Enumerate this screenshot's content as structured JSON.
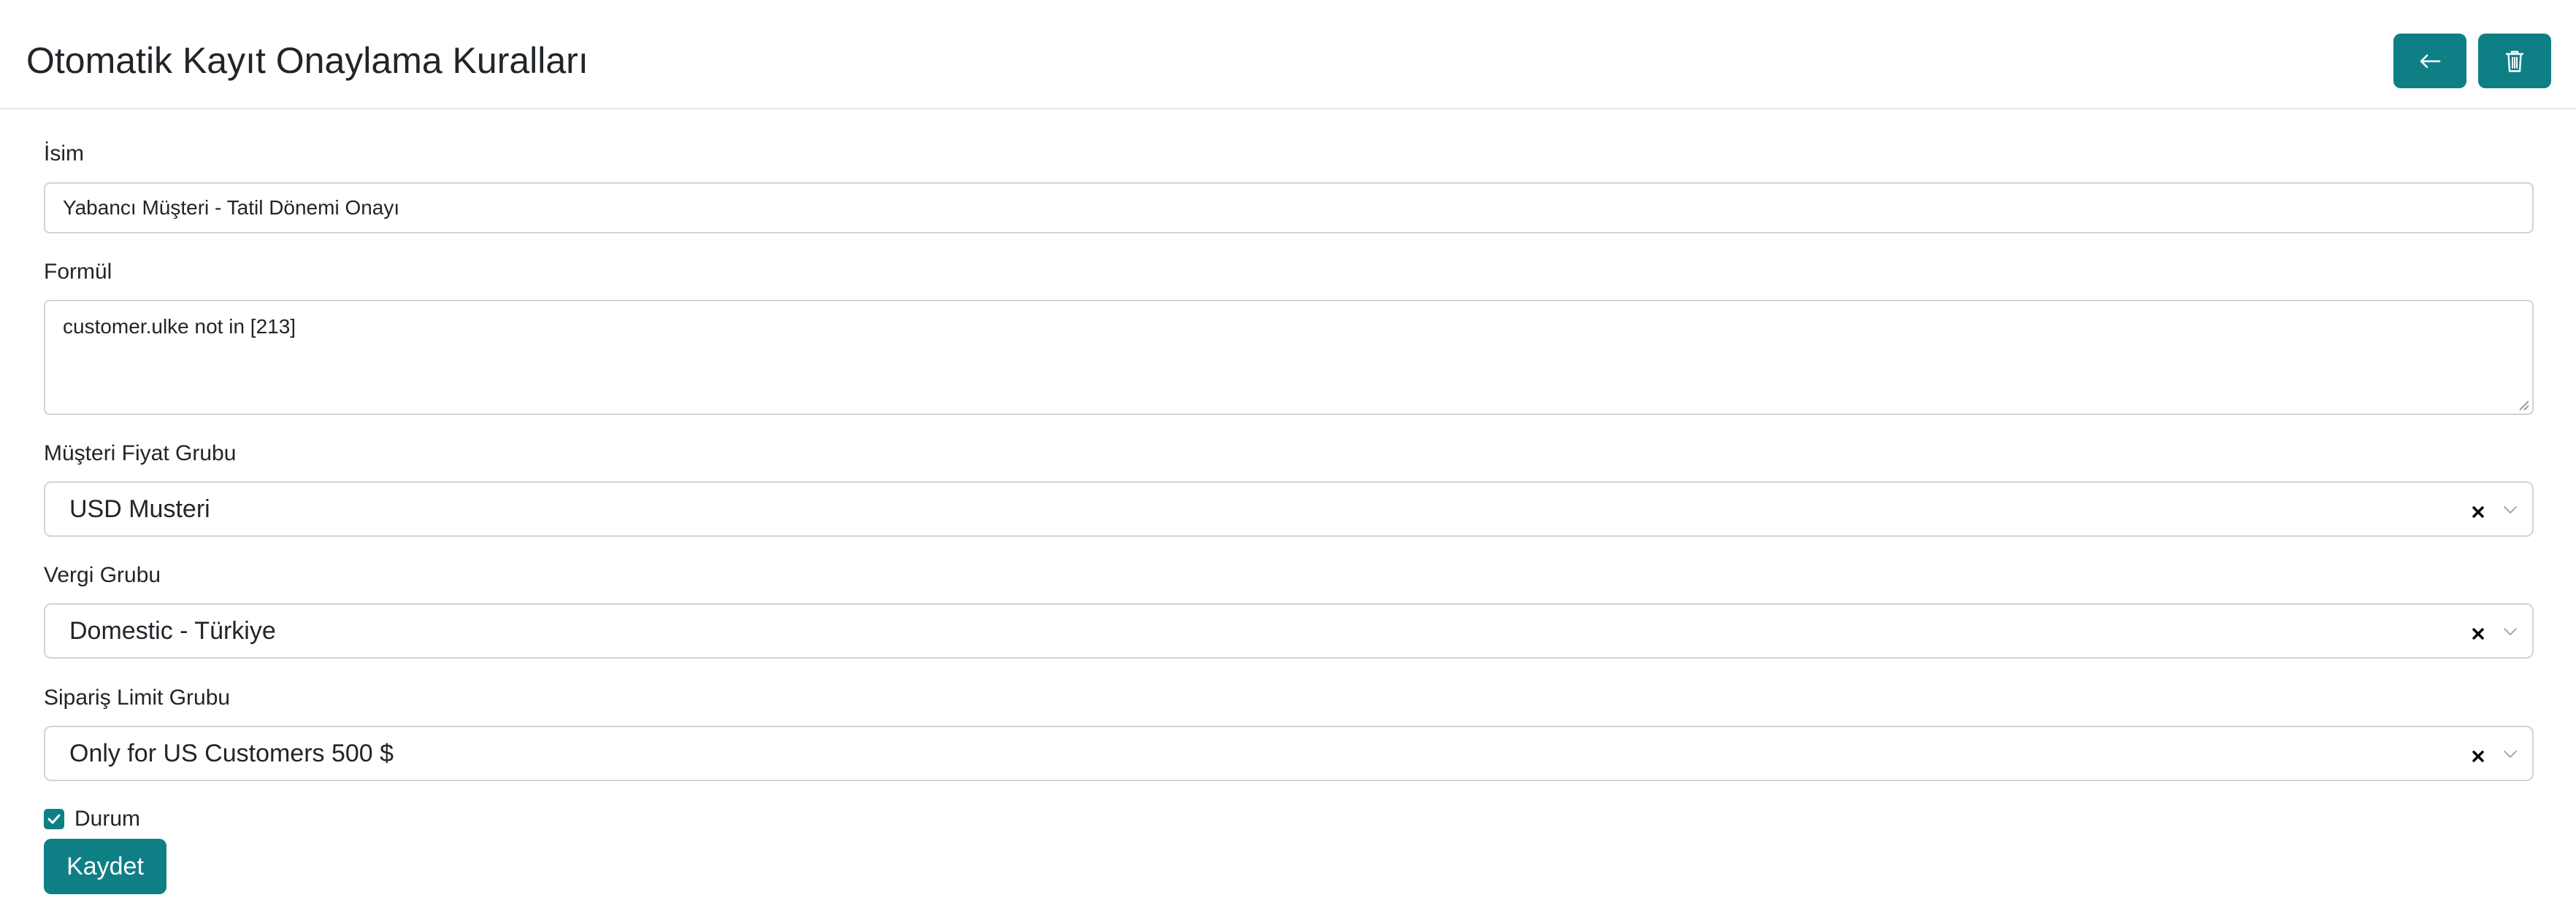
{
  "header": {
    "title": "Otomatik Kayıt Onaylama Kuralları",
    "back_icon": "arrow-left-icon",
    "delete_icon": "trash-icon"
  },
  "form": {
    "name": {
      "label": "İsim",
      "value": "Yabancı Müşteri - Tatil Dönemi Onayı"
    },
    "formula": {
      "label": "Formül",
      "value": "customer.ulke not in [213]"
    },
    "price_group": {
      "label": "Müşteri Fiyat Grubu",
      "value": "USD Musteri"
    },
    "tax_group": {
      "label": "Vergi Grubu",
      "value": "Domestic - Türkiye"
    },
    "order_limit_group": {
      "label": "Sipariş Limit Grubu",
      "value": "Only for US Customers 500 $"
    },
    "status": {
      "label": "Durum",
      "checked": true
    },
    "save_label": "Kaydet"
  },
  "colors": {
    "accent": "#0f7f86",
    "border": "#ced4da",
    "text": "#212529"
  }
}
